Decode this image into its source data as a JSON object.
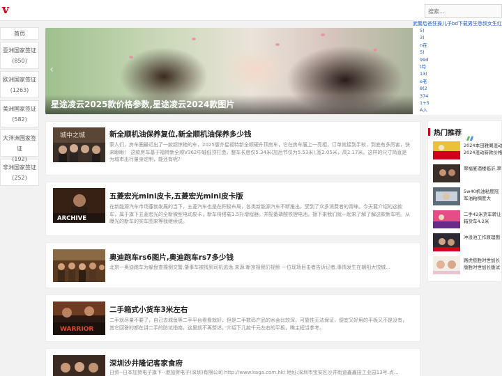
{
  "header": {
    "logo": "v",
    "search_placeholder": "搜索..."
  },
  "nav": {
    "home": "首页",
    "items": [
      {
        "label": "亚洲国家签证",
        "count": "(850)"
      },
      {
        "label": "欧洲国家签证",
        "count": "(1263)"
      },
      {
        "label": "美洲国家签证",
        "count": "(582)"
      },
      {
        "label": "大洋洲国家签证",
        "count": "(192)"
      },
      {
        "label": "非洲国家签证",
        "count": "(252)"
      }
    ]
  },
  "hero": {
    "title": "星途凌云2025款价格参数,星途凌云2024款图片"
  },
  "ticker": {
    "line1": "武警后爸狂操儿子bd下载男生憋叔女生红桃九女",
    "col": [
      "5)",
      "3)",
      "n在",
      "5)",
      "99d",
      "t苟",
      "13(",
      "e老",
      "8(2",
      "374",
      "1+5",
      "A入",
      "1(6",
      "0+7",
      "j操"
    ]
  },
  "articles": [
    {
      "title": "新全顺机油保养复位,新全顺机油保养多少钱",
      "desc": "家人们，房车圈最近出了一款超惊艳的车，2025版齐星福特新全顺硬升顶房车，它在房车展上一亮相，订单就接到手软，到底有多厉害，快来瞅瞅！ 这款房车基于福特新全顺V362中轴低顶打造，整车长度仅5.34米(加后节仅为5.53米),宽2.05米，高2.17米。这样的尺寸简直是为城市出行量身定制，能还有呢?"
    },
    {
      "title": "五菱宏光mini皮卡,五菱宏光mini皮卡版",
      "desc": "在新能源汽车市场蓬勃发展的当下，五菱汽车也是在积极布局，各类新能源汽车不断推出，受到了众多消费者的青睐。今天要介绍的这款车，属于旗下五菱宏光的全新微型电动皮卡，新车将搭载1.5升增程器，并配备磷酸铁锂电池。接下来我们就一起来了解了解这款新车吧。从曝光的新车的实车图来等我继续说。"
    },
    {
      "title": "奥迪跑车rs6图片,奥迪跑车rs7多少钱",
      "desc": "北京一奥迪跑车为躲盘查撞倒交警,肇事车被找到司机逃逸.来源:新京报我们视频 一位现场目击者告诉记者,事情发生在朝阳大悦城..."
    },
    {
      "title": "二手箱式小货车3米左右",
      "desc": "二手就尽量不要了，自己去城鱼等二手平台看看就好，但是二手数码产品的水会比较深，可靠性无法保证，便宜又好用的平板又不是没有，其它回答的都在讲二手的防坑指南，这里就不再赘述，介绍下几款千元左右的平板，瞧主程当参考。"
    },
    {
      "title": "深圳沙井隆记客家食府",
      "desc": "日资--日本加贺电子旗下--港加贺电子(深圳)有限公司 http://www.kaga.com.hk/ 地址:深圳市宝安区沙井街道鑫鑫田工业园13号.点..."
    }
  ],
  "thumb_captions": {
    "a1": "城中之城",
    "a2": "ARCHIVE",
    "a4": "WARRIOR"
  },
  "hot": {
    "title": "热门推荐",
    "items": [
      "2024本田雅阁混动2024混动新款价格",
      "翠福宴酒楼临沂,翠",
      "5w40机油粘度冠军油粘稠度大",
      "二手42米货车转让箱货车4.2米",
      "冲浪池工作原理图",
      "路虎揽胜时世加长版胜时世加长版试驾"
    ]
  },
  "colors": {
    "brand": "#d0021b",
    "link": "#1a56c7",
    "background": "#f2f2f2"
  }
}
